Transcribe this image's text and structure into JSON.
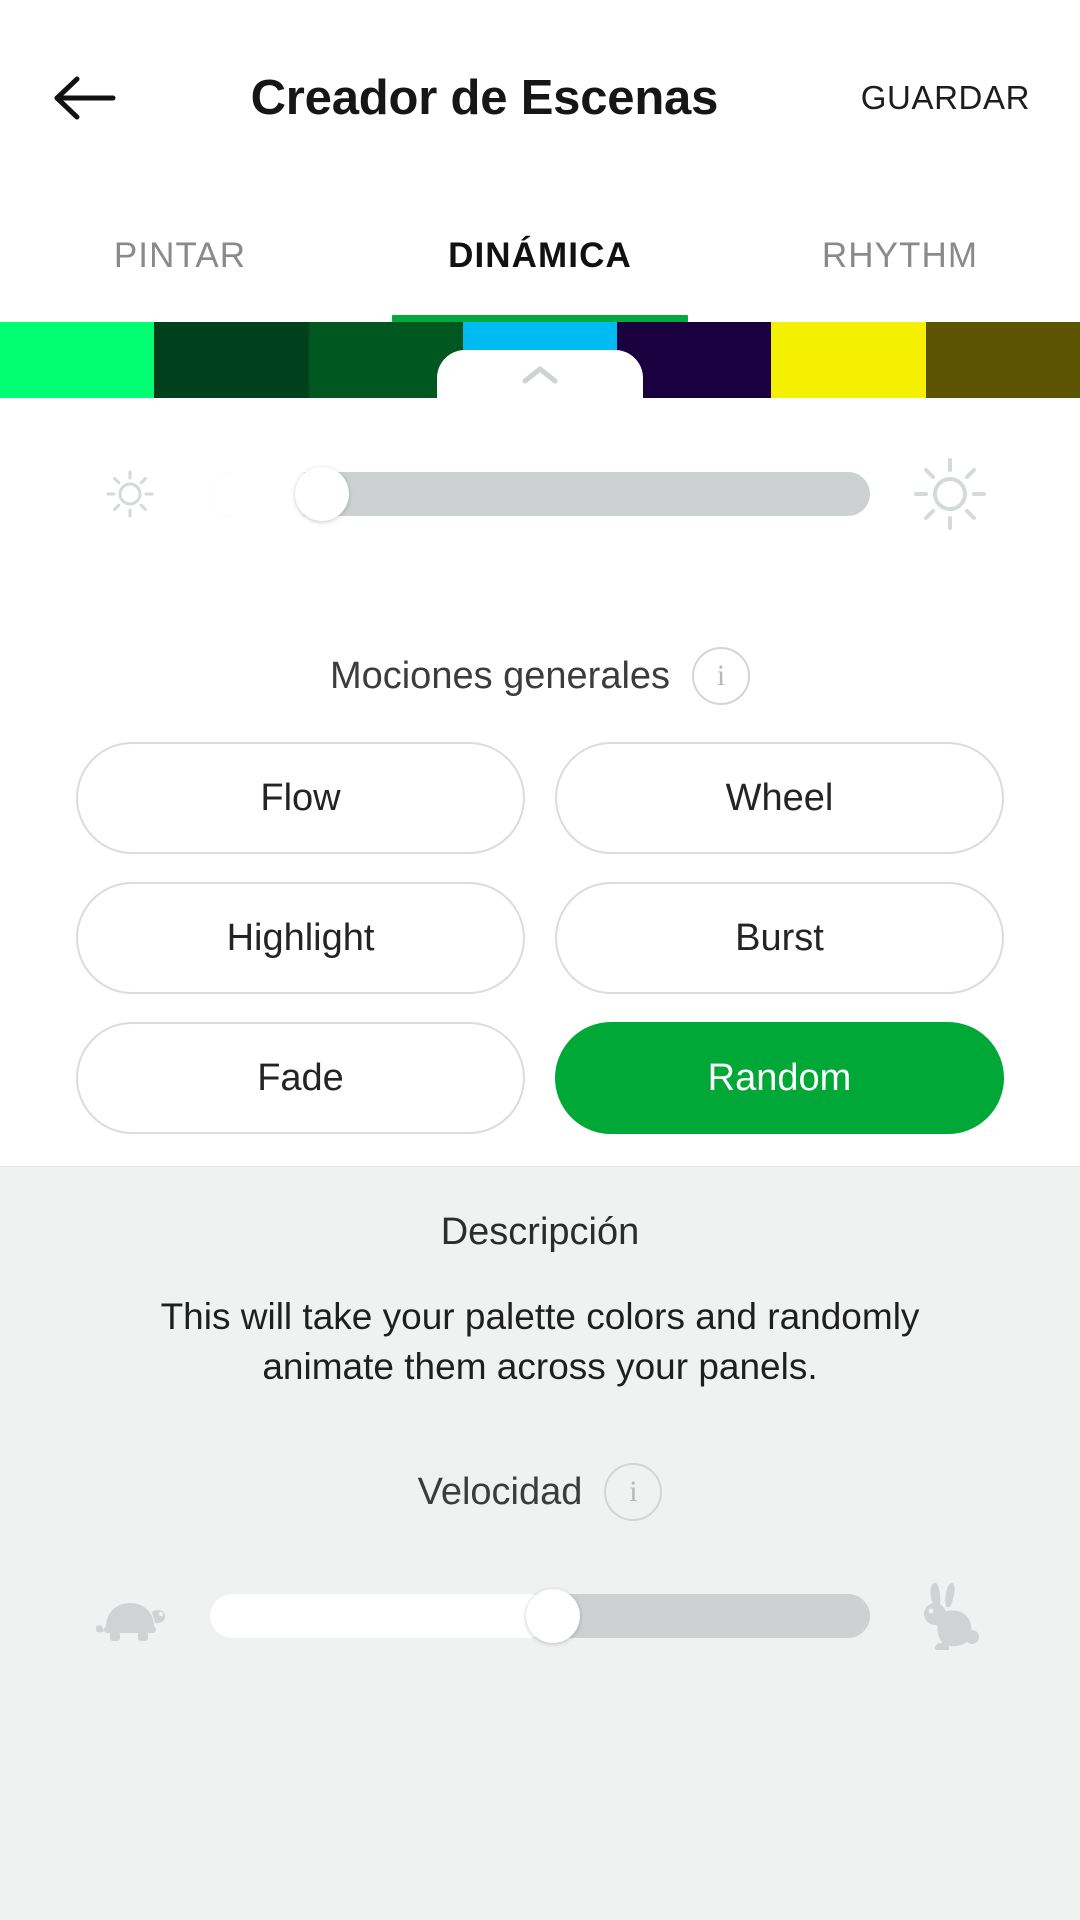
{
  "header": {
    "back_icon": "back-arrow-icon",
    "title": "Creador de Escenas",
    "save_label": "GUARDAR"
  },
  "tabs": [
    {
      "label": "PINTAR",
      "active": false
    },
    {
      "label": "DINÁMICA",
      "active": true
    },
    {
      "label": "RHYTHM",
      "active": false
    }
  ],
  "palette": {
    "handle_icon": "chevron-up-icon",
    "colors": [
      "#00FF72",
      "#00401C",
      "#00571F",
      "#00BBF2",
      "#1B003F",
      "#F5F000",
      "#5C5400"
    ]
  },
  "brightness": {
    "left_icon": "sun-small-icon",
    "right_icon": "sun-large-icon",
    "value": 17,
    "min": 0,
    "max": 100
  },
  "motions": {
    "label": "Mociones generales",
    "info_icon": "info-icon",
    "info_glyph": "i",
    "buttons": [
      {
        "label": "Flow",
        "selected": false
      },
      {
        "label": "Wheel",
        "selected": false
      },
      {
        "label": "Highlight",
        "selected": false
      },
      {
        "label": "Burst",
        "selected": false
      },
      {
        "label": "Fade",
        "selected": false
      },
      {
        "label": "Random",
        "selected": true
      }
    ]
  },
  "description": {
    "title": "Descripción",
    "body": "This will take your palette colors and randomly animate them across your panels."
  },
  "speed": {
    "label": "Velocidad",
    "info_icon": "info-icon",
    "info_glyph": "i",
    "left_icon": "turtle-icon",
    "right_icon": "rabbit-icon",
    "value": 52,
    "min": 0,
    "max": 100
  },
  "colors": {
    "accent_green": "#00A838",
    "tab_indicator": "#00AA3C",
    "panel_bg": "#F0F2F1",
    "track": "#CDD1D2"
  }
}
